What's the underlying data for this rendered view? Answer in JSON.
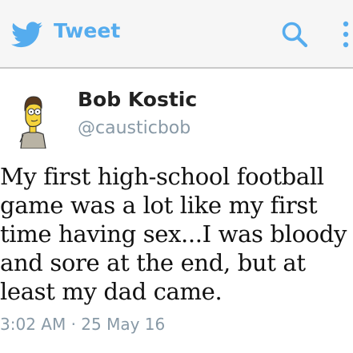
{
  "header": {
    "title": "Tweet",
    "accent_color": "#55acee",
    "icons": [
      "twitter-bird-icon",
      "search-icon",
      "more-vertical-icon"
    ]
  },
  "tweet": {
    "author_name": "Bob Kostic",
    "author_handle": "@causticbob",
    "avatar_icon": "cartoon-avatar",
    "text": "My first high-school football\ngame was a lot like my first\ntime having sex...I was bloody\nand sore at the end, but at\nleast my dad came.",
    "timestamp": "3:02 AM · 25 May 16"
  }
}
